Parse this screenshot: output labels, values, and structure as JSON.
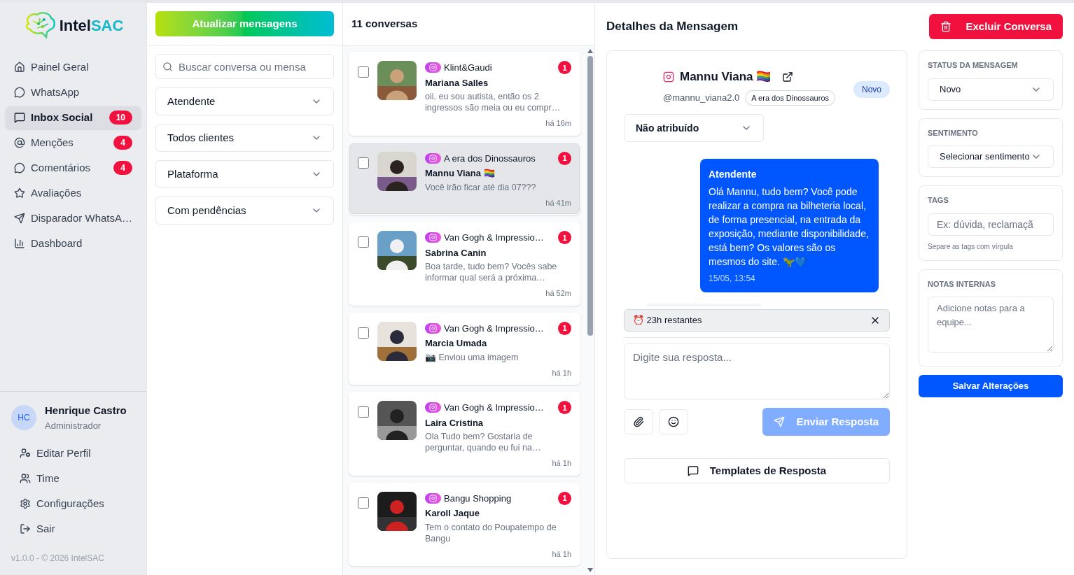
{
  "brand": {
    "name_part1": "Intel",
    "name_part2": "SAC"
  },
  "nav": [
    {
      "label": "Painel Geral",
      "selected": false
    },
    {
      "label": "WhatsApp",
      "selected": false
    },
    {
      "label": "Inbox Social",
      "selected": true,
      "badge": "10"
    },
    {
      "label": "Menções",
      "selected": false,
      "badge": "4"
    },
    {
      "label": "Comentários",
      "selected": false,
      "badge": "4"
    },
    {
      "label": "Avaliações",
      "selected": false
    },
    {
      "label": "Disparador WhatsA…",
      "selected": false
    },
    {
      "label": "Dashboard",
      "selected": false
    }
  ],
  "user": {
    "initials": "HC",
    "name": "Henrique Castro",
    "role": "Administrador"
  },
  "user_menu": [
    "Editar Perfil",
    "Time",
    "Configurações",
    "Sair"
  ],
  "footer": "v1.0.0 - © 2026 IntelSAC",
  "filters": {
    "refresh_button": "Atualizar mensagens",
    "search_placeholder": "Buscar conversa ou mensa",
    "selects": [
      "Atendente",
      "Todos clientes",
      "Plataforma",
      "Com pendências"
    ]
  },
  "conversation_list": {
    "count": "11 conversas",
    "items": [
      {
        "account": "Klint&Gaudi",
        "name": "Mariana Salles",
        "preview": "oii. eu sou autista, então os 2 ingressos são meia ou eu compr…",
        "time": "há 16m",
        "unread": "1",
        "selected": false,
        "checked": false
      },
      {
        "account": "A era dos Dinossauros",
        "name": "Mannu Viana 🏳️‍🌈",
        "preview": "Você irão ficar até dia 07???",
        "time": "há 41m",
        "unread": "1",
        "selected": true,
        "checked": false
      },
      {
        "account": "Van Gogh & Impressio…",
        "name": "Sabrina Canin",
        "preview": "Boa tarde, tudo bem? Vocês sabe informar qual será a próxima…",
        "time": "há 52m",
        "unread": "1",
        "selected": false,
        "checked": false
      },
      {
        "account": "Van Gogh & Impressio…",
        "name": "Marcia Umada",
        "preview": "📷 Enviou uma imagem",
        "time": "há 1h",
        "unread": "1",
        "selected": false,
        "checked": false
      },
      {
        "account": "Van Gogh & Impressio…",
        "name": "Laira Cristina",
        "preview": "Ola Tudo bem? Gostaria de perguntar, quando eu fui na…",
        "time": "há 1h",
        "unread": "1",
        "selected": false,
        "checked": false
      },
      {
        "account": "Bangu Shopping",
        "name": "Karoll Jaque",
        "preview": "Tem o contato do Poupatempo de Bangu",
        "time": "há 1h",
        "unread": "1",
        "selected": false,
        "checked": false
      }
    ]
  },
  "details": {
    "title": "Detalhes da Mensagem",
    "delete_button": "Excluir Conversa",
    "contact": {
      "name": "Mannu Viana 🏳️‍🌈",
      "handle": "@mannu_viana2.0",
      "account_tag": "A era dos Dinossauros",
      "status_badge": "Novo"
    },
    "assignee_select": "Não atribuído",
    "message": {
      "author": "Atendente",
      "text": "Olá Mannu, tudo bem? Você pode realizar a compra na bilheteria local, de forma presencial, na entrada da exposição, mediante disponibilidade, está bem? Os valores são os mesmos do site. 🦖💙",
      "time": "15/05, 13:54"
    },
    "timer": "⏰ 23h restantes",
    "reply_placeholder": "Digite sua resposta...",
    "send_button": "Enviar Resposta",
    "send_disabled": true,
    "templates_button": "Templates de Resposta"
  },
  "side_panel": {
    "status": {
      "label": "STATUS DA MENSAGEM",
      "value": "Novo"
    },
    "sentiment": {
      "label": "SENTIMENTO",
      "value": "Selecionar sentimento"
    },
    "tags": {
      "label": "TAGS",
      "placeholder": "Ex: dúvida, reclamaçã",
      "hint": "Separe as tags com vírgula"
    },
    "notes": {
      "label": "NOTAS INTERNAS",
      "placeholder": "Adicione notas para a equipe..."
    },
    "save_button": "Salvar Alterações"
  }
}
